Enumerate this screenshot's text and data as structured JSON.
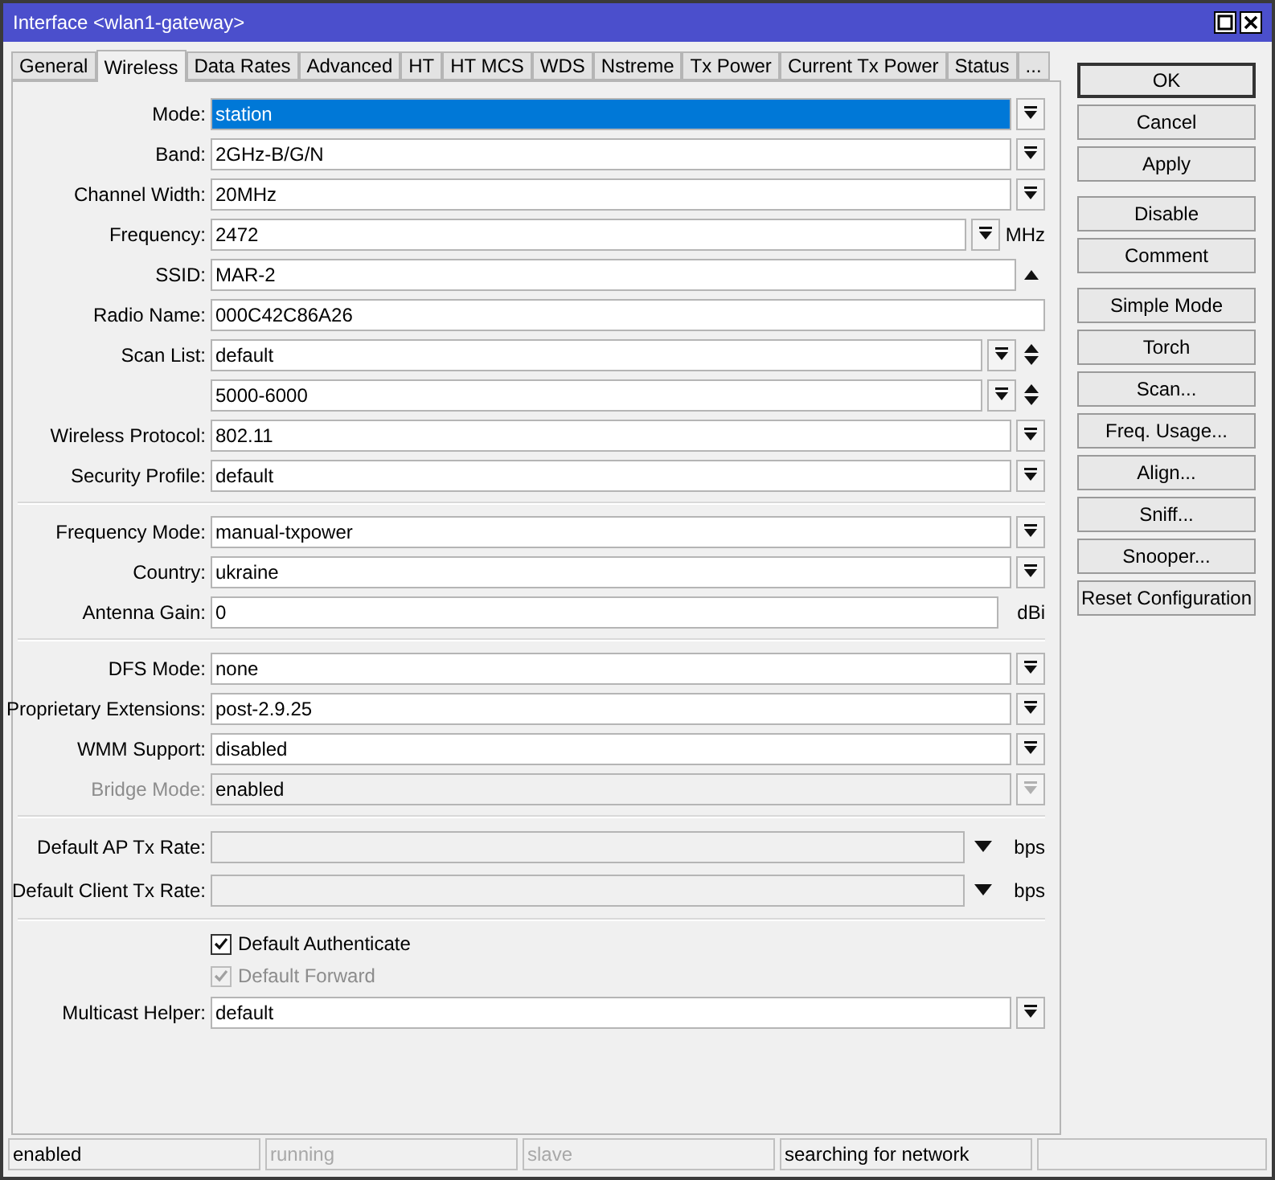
{
  "window": {
    "title": "Interface <wlan1-gateway>"
  },
  "tabs": [
    {
      "label": "General",
      "selected": false
    },
    {
      "label": "Wireless",
      "selected": true
    },
    {
      "label": "Data Rates",
      "selected": false
    },
    {
      "label": "Advanced",
      "selected": false
    },
    {
      "label": "HT",
      "selected": false
    },
    {
      "label": "HT MCS",
      "selected": false
    },
    {
      "label": "WDS",
      "selected": false
    },
    {
      "label": "Nstreme",
      "selected": false
    },
    {
      "label": "Tx Power",
      "selected": false
    },
    {
      "label": "Current Tx Power",
      "selected": false
    },
    {
      "label": "Status",
      "selected": false
    },
    {
      "label": "...",
      "selected": false
    }
  ],
  "form_groups": [
    {
      "rows": [
        {
          "kind": "select",
          "label": "Mode:",
          "value": "station",
          "selected": true,
          "disabled": false
        },
        {
          "kind": "select",
          "label": "Band:",
          "value": "2GHz-B/G/N",
          "selected": false,
          "disabled": false
        },
        {
          "kind": "select",
          "label": "Channel Width:",
          "value": "20MHz",
          "selected": false,
          "disabled": false
        },
        {
          "kind": "select",
          "label": "Frequency:",
          "value": "2472",
          "unit": "MHz",
          "selected": false,
          "disabled": false
        },
        {
          "kind": "history",
          "label": "SSID:",
          "value": "MAR-2",
          "selected": false,
          "disabled": false
        },
        {
          "kind": "text",
          "label": "Radio Name:",
          "value": "000C42C86A26",
          "selected": false,
          "disabled": false
        },
        {
          "kind": "list",
          "label": "Scan List:",
          "value": "default",
          "selected": false,
          "disabled": false
        },
        {
          "kind": "list",
          "value": "5000-6000",
          "selected": false,
          "disabled": false
        },
        {
          "kind": "select",
          "label": "Wireless Protocol:",
          "value": "802.11",
          "selected": false,
          "disabled": false
        },
        {
          "kind": "select",
          "label": "Security Profile:",
          "value": "default",
          "selected": false,
          "disabled": false
        }
      ]
    },
    {
      "rows": [
        {
          "kind": "select",
          "label": "Frequency Mode:",
          "value": "manual-txpower",
          "selected": false,
          "disabled": false
        },
        {
          "kind": "select",
          "label": "Country:",
          "value": "ukraine",
          "selected": false,
          "disabled": false
        },
        {
          "kind": "text",
          "label": "Antenna Gain:",
          "value": "0",
          "unit": "dBi",
          "selected": false,
          "disabled": false
        }
      ]
    },
    {
      "rows": [
        {
          "kind": "select",
          "label": "DFS Mode:",
          "value": "none",
          "selected": false,
          "disabled": false
        },
        {
          "kind": "select",
          "label": "Proprietary Extensions:",
          "value": "post-2.9.25",
          "selected": false,
          "disabled": false
        },
        {
          "kind": "select",
          "label": "WMM Support:",
          "value": "disabled",
          "selected": false,
          "disabled": false
        },
        {
          "kind": "select",
          "label": "Bridge Mode:",
          "value": "enabled",
          "selected": false,
          "disabled": true
        }
      ]
    },
    {
      "rows": [
        {
          "kind": "rate",
          "label": "Default AP Tx Rate:",
          "unit": "bps",
          "selected": false,
          "disabled": false
        },
        {
          "kind": "rate",
          "label": "Default Client Tx Rate:",
          "unit": "bps",
          "selected": false,
          "disabled": false
        }
      ]
    },
    {
      "rows": [
        {
          "kind": "checkbox",
          "value": "Default Authenticate",
          "checked": true,
          "disabled": false
        },
        {
          "kind": "checkbox",
          "value": "Default Forward",
          "checked": true,
          "disabled": true
        },
        {
          "kind": "select",
          "label": "Multicast Helper:",
          "value": "default",
          "selected": false,
          "disabled": false
        }
      ]
    }
  ],
  "button_groups": [
    {
      "buttons": [
        {
          "label": "OK",
          "default": true
        },
        {
          "label": "Cancel",
          "default": false
        },
        {
          "label": "Apply",
          "default": false
        }
      ]
    },
    {
      "buttons": [
        {
          "label": "Disable",
          "default": false
        },
        {
          "label": "Comment",
          "default": false
        }
      ]
    },
    {
      "buttons": [
        {
          "label": "Simple Mode",
          "default": false
        },
        {
          "label": "Torch",
          "default": false
        },
        {
          "label": "Scan...",
          "default": false
        },
        {
          "label": "Freq. Usage...",
          "default": false
        },
        {
          "label": "Align...",
          "default": false
        },
        {
          "label": "Sniff...",
          "default": false
        },
        {
          "label": "Snooper...",
          "default": false
        },
        {
          "label": "Reset Configuration",
          "default": false
        }
      ]
    }
  ],
  "status_bar": [
    {
      "text": "enabled",
      "disabled": false
    },
    {
      "text": "running",
      "disabled": true
    },
    {
      "text": "slave",
      "disabled": true
    },
    {
      "text": "searching for network",
      "disabled": false
    }
  ]
}
